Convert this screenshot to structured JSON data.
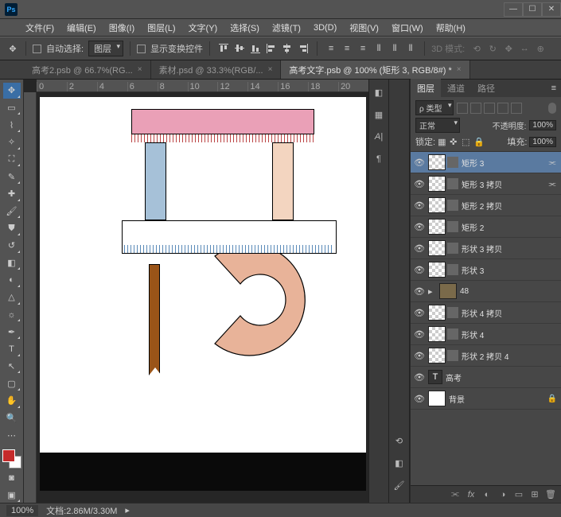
{
  "titlebar": {
    "ps_text": "Ps"
  },
  "menubar": {
    "items": [
      "文件(F)",
      "编辑(E)",
      "图像(I)",
      "图层(L)",
      "文字(Y)",
      "选择(S)",
      "滤镜(T)",
      "3D(D)",
      "视图(V)",
      "窗口(W)",
      "帮助(H)"
    ]
  },
  "optbar": {
    "auto_select": "自动选择:",
    "mode": "图层",
    "show_transform": "显示变换控件",
    "mode3d": "3D 模式:"
  },
  "tabs": {
    "t1": "高考2.psb @ 66.7%(RG...",
    "t2": "素材.psd @ 33.3%(RGB/...",
    "t3": "高考文字.psb @ 100% (矩形 3, RGB/8#) *"
  },
  "ruler_marks": [
    "0",
    "2",
    "4",
    "6",
    "8",
    "10",
    "12",
    "14",
    "16",
    "18",
    "20"
  ],
  "panels": {
    "layers_tab": "图层",
    "channels_tab": "通道",
    "paths_tab": "路径",
    "kind_label": "ρ 类型",
    "blend": "正常",
    "opacity_label": "不透明度:",
    "opacity_val": "100%",
    "lock_label": "锁定:",
    "fill_label": "填充:",
    "fill_val": "100%"
  },
  "layers": [
    {
      "name": "矩形 3",
      "sel": true,
      "link": true
    },
    {
      "name": "矩形 3 拷贝",
      "link": true
    },
    {
      "name": "矩形 2 拷贝"
    },
    {
      "name": "矩形 2"
    },
    {
      "name": "形状 3 拷贝"
    },
    {
      "name": "形状 3"
    },
    {
      "name": "48",
      "folder": true
    },
    {
      "name": "形状 4 拷贝"
    },
    {
      "name": "形状 4"
    },
    {
      "name": "形状 2 拷贝 4"
    },
    {
      "name": "高考",
      "text": true
    },
    {
      "name": "背景",
      "bg": true
    }
  ],
  "status": {
    "zoom": "100%",
    "docinfo": "文档:2.86M/3.30M"
  }
}
